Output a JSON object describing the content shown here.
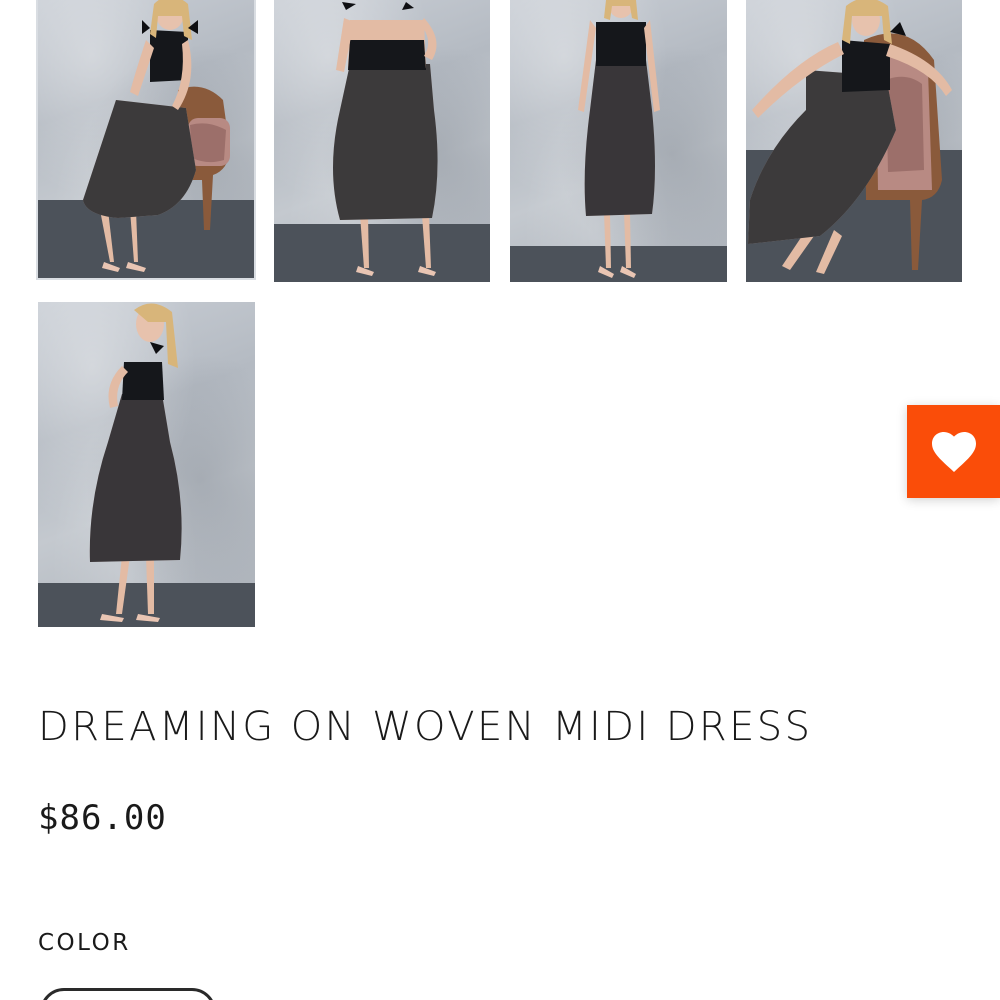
{
  "gallery": {
    "thumbnails": [
      {
        "alt": "model-seated-front",
        "selected": true
      },
      {
        "alt": "model-standing-back",
        "selected": false
      },
      {
        "alt": "model-standing-front",
        "selected": false
      },
      {
        "alt": "model-seated-side",
        "selected": false
      },
      {
        "alt": "model-standing-profile",
        "selected": false
      }
    ]
  },
  "product": {
    "title": "DREAMING ON WOVEN MIDI DRESS",
    "price": "$86.00"
  },
  "options": {
    "color_label": "COLOR"
  },
  "wishlist": {
    "icon": "heart-icon",
    "color": "#fa4d09"
  },
  "colors": {
    "accent": "#fa4d09",
    "text": "#1a1a1a",
    "dress": "#15171b",
    "lining": "#c9b4ad",
    "floor": "#4c525a",
    "wall": "#bfc4cb"
  }
}
